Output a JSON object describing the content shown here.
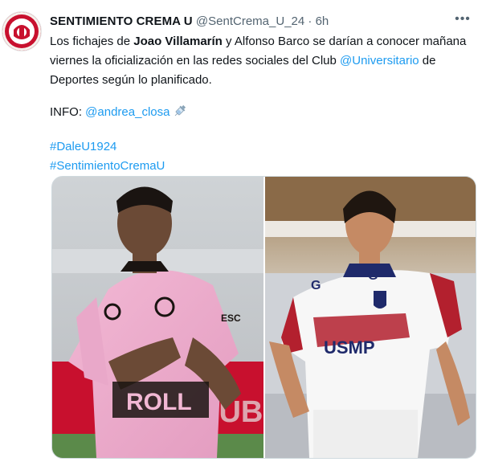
{
  "tweet": {
    "author_name": "SENTIMIENTO CREMA U",
    "handle": "@SentCrema_U_24",
    "separator": "·",
    "time": "6h",
    "more_label": "•••",
    "text": {
      "p1_a": "Los fichajes de ",
      "p1_b": "Joao Villamarín",
      "p1_c": " y Alfonso Barco se darían a conocer mañana viernes la oficialización en las redes sociales del Club ",
      "p1_mention": "@Universitario",
      "p1_d": " de Deportes según lo planificado.",
      "info_label": "INFO: ",
      "info_mention": "@andrea_closa",
      "hashtag1": "#DaleU1924",
      "hashtag2": "#SentimientoCremaU"
    },
    "media": {
      "left_jersey_text": "ROLL",
      "right_jersey_text": "USMP",
      "right_jersey_sponsor": "G",
      "left_banner_text": "DUBAI",
      "left_jersey_small": "ESC"
    },
    "colors": {
      "link": "#1d9bf0",
      "muted": "#536471",
      "avatar_red": "#c8102e"
    },
    "icons": [
      "avatar-logo",
      "more-icon",
      "syringe-icon"
    ]
  }
}
